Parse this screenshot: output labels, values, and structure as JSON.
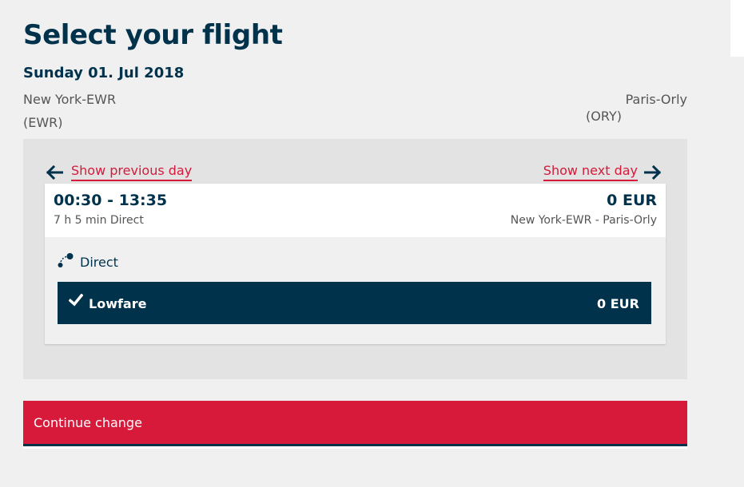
{
  "page": {
    "title": "Select your flight",
    "date": "Sunday 01. Jul 2018"
  },
  "route": {
    "origin_city": "New York-EWR",
    "origin_code": "(EWR)",
    "destination_city": "Paris-Orly",
    "destination_code": "(ORY)"
  },
  "navigation": {
    "previous_label": "Show previous day",
    "next_label": "Show next day",
    "prev_icon": "arrow-left-icon",
    "next_icon": "arrow-right-icon"
  },
  "flight": {
    "times": "00:30 - 13:35",
    "duration": "7 h 5 min Direct",
    "price": "0 EUR",
    "route": "New York-EWR - Paris-Orly",
    "stops_label": "Direct",
    "stops_icon": "direct-route-icon"
  },
  "fare": {
    "name": "Lowfare",
    "price": "0 EUR",
    "selected": true,
    "icon": "checkmark-icon"
  },
  "actions": {
    "continue_label": "Continue change"
  },
  "colors": {
    "primary_navy": "#00324c",
    "accent_red": "#d7193a",
    "background": "#f0f0f0",
    "panel": "#e3e3e3"
  }
}
